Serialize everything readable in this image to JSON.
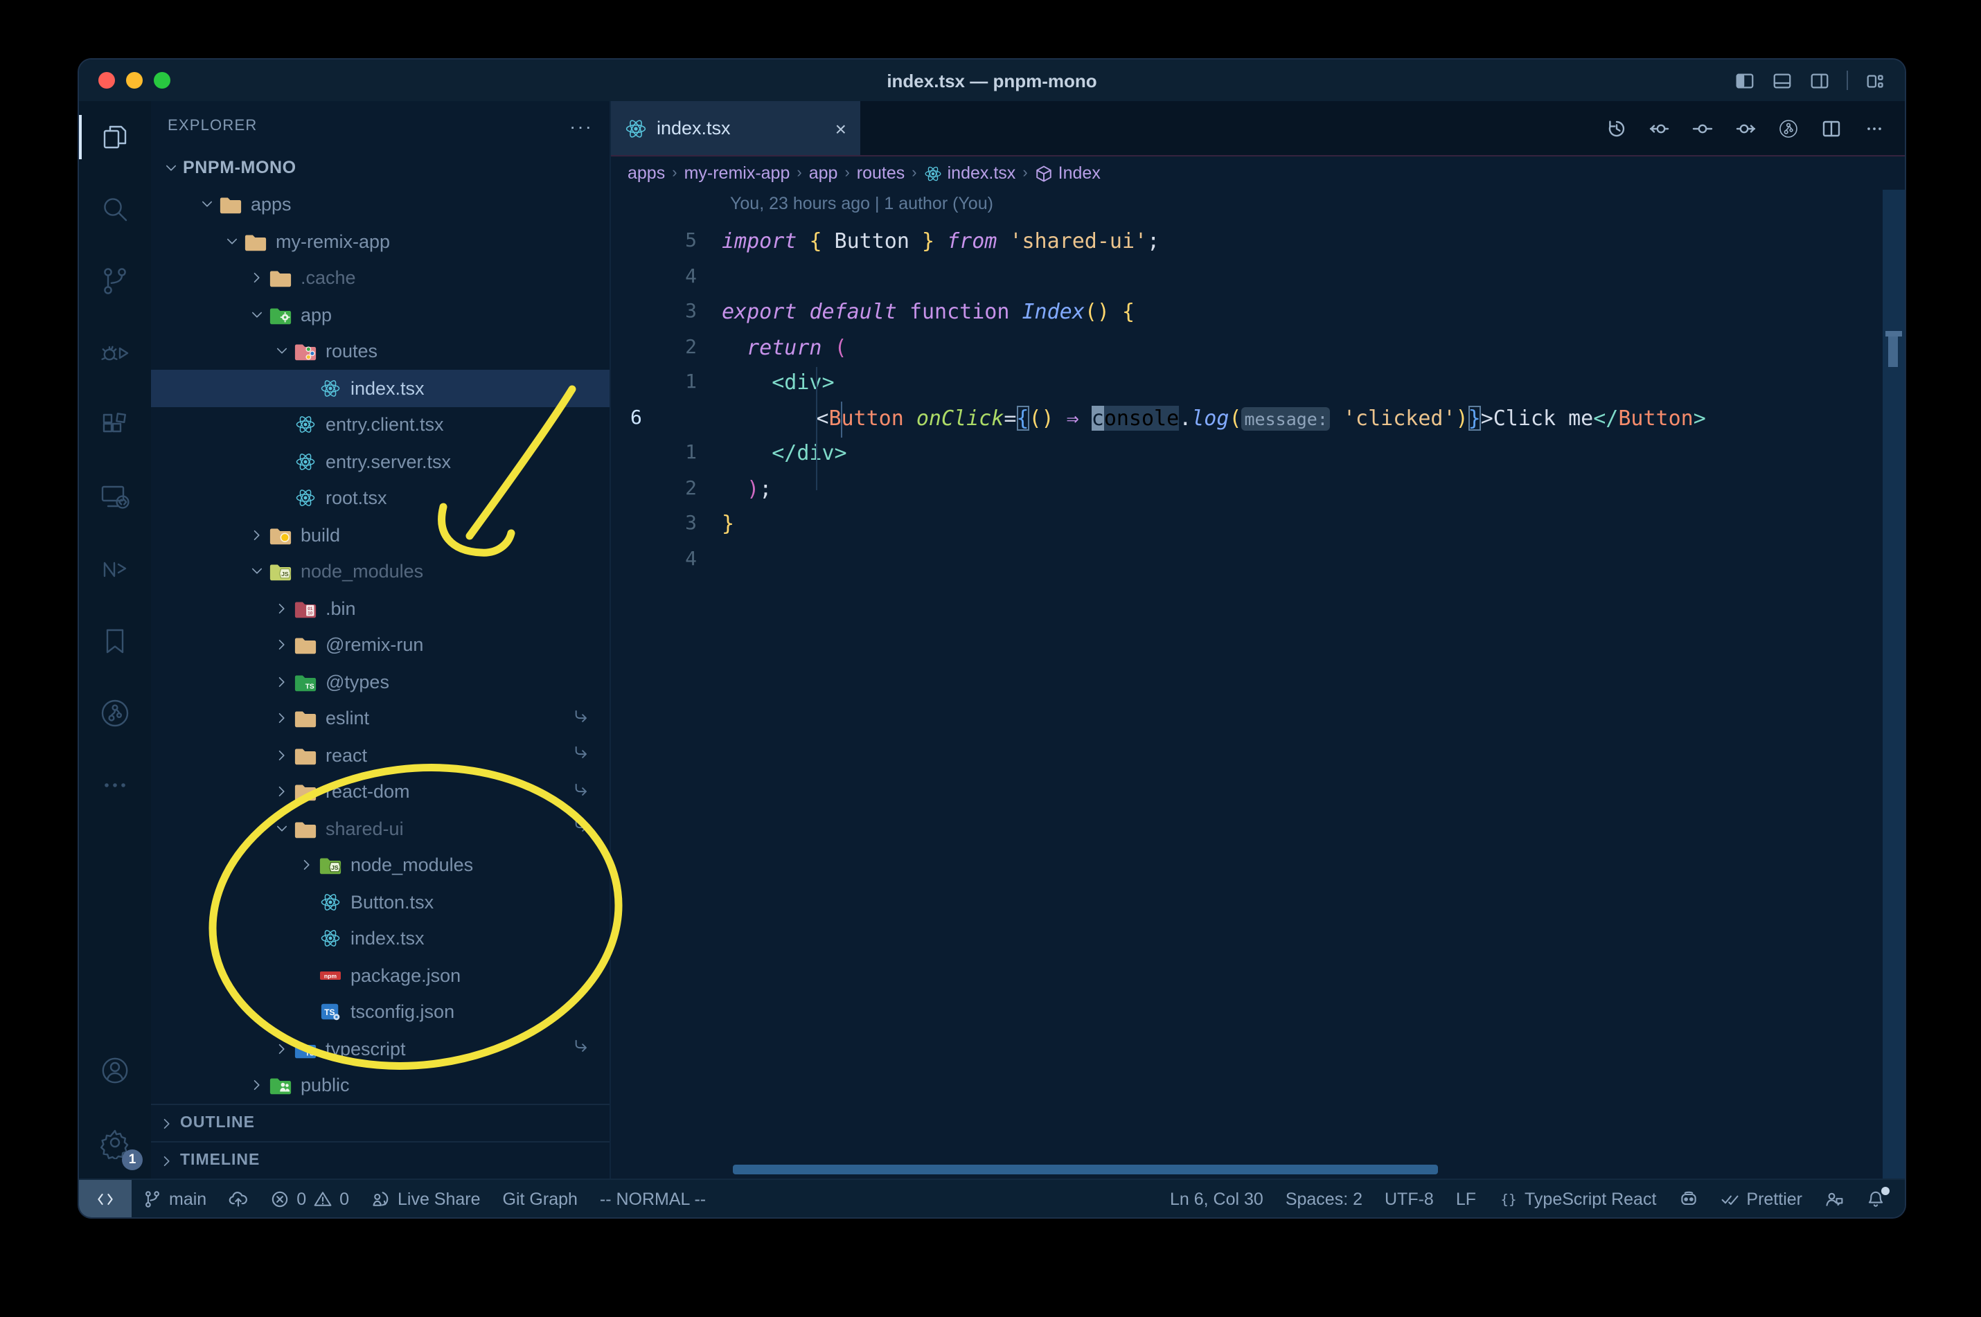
{
  "window": {
    "title": "index.tsx — pnpm-mono"
  },
  "titlebar": {
    "traffic_lights": [
      {
        "name": "close",
        "color": "#ff5f57"
      },
      {
        "name": "minimize",
        "color": "#febc2e"
      },
      {
        "name": "zoom",
        "color": "#28c840"
      }
    ],
    "right_icons": [
      "layout-sidebar-left",
      "layout-panel",
      "layout-sidebar-right",
      "separator",
      "customize-layout"
    ]
  },
  "activity_bar": {
    "top": [
      {
        "name": "explorer",
        "icon": "files",
        "active": true
      },
      {
        "name": "search",
        "icon": "search",
        "active": false
      },
      {
        "name": "source-control",
        "icon": "git-branch-big",
        "active": false
      },
      {
        "name": "run-debug",
        "icon": "debug",
        "active": false
      },
      {
        "name": "extensions",
        "icon": "extensions",
        "active": false
      },
      {
        "name": "remote-explorer",
        "icon": "remote-monitor",
        "active": false
      },
      {
        "name": "nx-console",
        "icon": "nx",
        "active": false
      },
      {
        "name": "bookmarks",
        "icon": "bookmark",
        "active": false
      },
      {
        "name": "git-graph",
        "icon": "git-graph-circle",
        "active": false
      },
      {
        "name": "more",
        "icon": "ellipsis",
        "active": false
      }
    ],
    "bottom": [
      {
        "name": "account",
        "icon": "account",
        "badge": null
      },
      {
        "name": "settings",
        "icon": "gear",
        "badge": "1"
      }
    ]
  },
  "sidebar": {
    "header": "EXPLORER",
    "header_more": "···",
    "root": "PNPM-MONO",
    "tree": [
      {
        "label": "apps",
        "icon": "folder",
        "level": 1,
        "chevron": "down"
      },
      {
        "label": "my-remix-app",
        "icon": "folder",
        "level": 2,
        "chevron": "down"
      },
      {
        "label": ".cache",
        "icon": "folder",
        "level": 3,
        "chevron": "right",
        "dim": true
      },
      {
        "label": "app",
        "icon": "folder-app",
        "level": 3,
        "chevron": "down"
      },
      {
        "label": "routes",
        "icon": "folder-routes",
        "level": 4,
        "chevron": "down"
      },
      {
        "label": "index.tsx",
        "icon": "react",
        "level": 5,
        "selected": true
      },
      {
        "label": "entry.client.tsx",
        "icon": "react",
        "level": 4
      },
      {
        "label": "entry.server.tsx",
        "icon": "react",
        "level": 4
      },
      {
        "label": "root.tsx",
        "icon": "react",
        "level": 4
      },
      {
        "label": "build",
        "icon": "folder-build",
        "level": 3,
        "chevron": "right"
      },
      {
        "label": "node_modules",
        "icon": "folder-js-pale",
        "level": 3,
        "chevron": "down",
        "dim": true
      },
      {
        "label": ".bin",
        "icon": "folder-bin",
        "level": 4,
        "chevron": "right"
      },
      {
        "label": "@remix-run",
        "icon": "folder",
        "level": 4,
        "chevron": "right"
      },
      {
        "label": "@types",
        "icon": "folder-ts-green",
        "level": 4,
        "chevron": "right"
      },
      {
        "label": "eslint",
        "icon": "folder",
        "level": 4,
        "chevron": "right",
        "symlink": true
      },
      {
        "label": "react",
        "icon": "folder",
        "level": 4,
        "chevron": "right",
        "symlink": true
      },
      {
        "label": "react-dom",
        "icon": "folder",
        "level": 4,
        "chevron": "right",
        "symlink": true
      },
      {
        "label": "shared-ui",
        "icon": "folder",
        "level": 4,
        "chevron": "down",
        "dim": true,
        "symlink": true
      },
      {
        "label": "node_modules",
        "icon": "folder-js-green",
        "level": 5,
        "chevron": "right"
      },
      {
        "label": "Button.tsx",
        "icon": "react",
        "level": 5
      },
      {
        "label": "index.tsx",
        "icon": "react",
        "level": 5
      },
      {
        "label": "package.json",
        "icon": "npm",
        "level": 5
      },
      {
        "label": "tsconfig.json",
        "icon": "tsconfig",
        "level": 5
      },
      {
        "label": "typescript",
        "icon": "folder-ts-blue",
        "level": 4,
        "chevron": "right",
        "symlink": true
      },
      {
        "label": "public",
        "icon": "folder-public",
        "level": 3,
        "chevron": "right"
      }
    ],
    "sections": [
      "OUTLINE",
      "TIMELINE"
    ]
  },
  "editor": {
    "tabs": [
      {
        "label": "index.tsx",
        "icon": "react",
        "close": "×",
        "active": true
      }
    ],
    "actions": [
      "history",
      "prev-change",
      "change",
      "next-change",
      "git-graph-circle",
      "split-editor",
      "ellipsis"
    ],
    "breadcrumbs": [
      {
        "label": "apps"
      },
      {
        "label": "my-remix-app"
      },
      {
        "label": "app"
      },
      {
        "label": "routes"
      },
      {
        "label": "index.tsx",
        "icon": "react"
      },
      {
        "label": "Index",
        "icon": "symbol-module"
      }
    ],
    "blame": "You, 23 hours ago | 1 author (You)",
    "code_lines": [
      {
        "num": "5",
        "tokens": [
          [
            "kw",
            "import"
          ],
          [
            "pl",
            " "
          ],
          [
            "by",
            "{"
          ],
          [
            "vr",
            " Button "
          ],
          [
            "by",
            "}"
          ],
          [
            "kw",
            " from"
          ],
          [
            "pl",
            " "
          ],
          [
            "st",
            "'shared-ui'"
          ],
          [
            "pl",
            ";"
          ]
        ]
      },
      {
        "num": "4",
        "tokens": []
      },
      {
        "num": "3",
        "tokens": [
          [
            "kw",
            "export"
          ],
          [
            "pl",
            " "
          ],
          [
            "kw",
            "default"
          ],
          [
            "pl",
            " "
          ],
          [
            "kwu",
            "function"
          ],
          [
            "pl",
            " "
          ],
          [
            "fn",
            "Index"
          ],
          [
            "by",
            "()"
          ],
          [
            "pl",
            " "
          ],
          [
            "by",
            "{"
          ]
        ]
      },
      {
        "num": "2",
        "tokens": [
          [
            "pl",
            "  "
          ],
          [
            "kw",
            "return"
          ],
          [
            "pl",
            " "
          ],
          [
            "bp",
            "("
          ]
        ]
      },
      {
        "num": "1",
        "tokens": [
          [
            "pl",
            "    "
          ],
          [
            "tg",
            "<div>"
          ]
        ]
      },
      {
        "num": "6",
        "active": true,
        "tokens": [
          [
            "pl",
            "      "
          ],
          [
            "pl",
            "<"
          ],
          [
            "cp",
            "Button"
          ],
          [
            "pl",
            " "
          ],
          [
            "at",
            "onClick"
          ],
          [
            "pl",
            "="
          ],
          [
            "bbx",
            "{"
          ],
          [
            "by",
            "()"
          ],
          [
            "pl",
            " "
          ],
          [
            "op",
            "⇒"
          ],
          [
            "pl",
            " "
          ],
          [
            "cur-blk",
            "c"
          ],
          [
            "hl",
            "onsole"
          ],
          [
            "pl",
            "."
          ],
          [
            "fn",
            "log"
          ],
          [
            "by",
            "("
          ],
          [
            "inlay",
            "message:"
          ],
          [
            "pl",
            " "
          ],
          [
            "st",
            "'clicked'"
          ],
          [
            "by",
            ")"
          ],
          [
            "bbx",
            "}"
          ],
          [
            "pl",
            ">"
          ],
          [
            "vr",
            "Click me"
          ],
          [
            "tg",
            "</"
          ],
          [
            "cp",
            "Button"
          ],
          [
            "tg",
            ">"
          ]
        ]
      },
      {
        "num": "1",
        "tokens": [
          [
            "pl",
            "    "
          ],
          [
            "tg",
            "</div>"
          ]
        ]
      },
      {
        "num": "2",
        "tokens": [
          [
            "pl",
            "  "
          ],
          [
            "bp",
            ")"
          ],
          [
            "pl",
            ";"
          ]
        ]
      },
      {
        "num": "3",
        "tokens": [
          [
            "by",
            "}"
          ]
        ]
      },
      {
        "num": "4",
        "tokens": []
      }
    ]
  },
  "status_bar": {
    "left": [
      {
        "name": "remote-indicator",
        "remote": true,
        "parts": [
          {
            "icon": "remote-chevrons"
          }
        ]
      },
      {
        "name": "git-branch",
        "parts": [
          {
            "icon": "branch"
          },
          {
            "text": "main"
          }
        ]
      },
      {
        "name": "sync",
        "parts": [
          {
            "icon": "cloud-upload"
          }
        ]
      },
      {
        "name": "problems",
        "parts": [
          {
            "icon": "error-circle"
          },
          {
            "text": "0"
          },
          {
            "icon": "warning-triangle"
          },
          {
            "text": "0"
          }
        ]
      },
      {
        "name": "live-share",
        "parts": [
          {
            "icon": "live-share"
          },
          {
            "text": "Live Share"
          }
        ]
      },
      {
        "name": "git-graph",
        "parts": [
          {
            "text": "Git Graph"
          }
        ]
      },
      {
        "name": "vim-mode",
        "parts": [
          {
            "text": "-- NORMAL --"
          }
        ]
      }
    ],
    "right": [
      {
        "name": "cursor-position",
        "parts": [
          {
            "text": "Ln 6, Col 30"
          }
        ]
      },
      {
        "name": "indentation",
        "parts": [
          {
            "text": "Spaces: 2"
          }
        ]
      },
      {
        "name": "encoding",
        "parts": [
          {
            "text": "UTF-8"
          }
        ]
      },
      {
        "name": "eol",
        "parts": [
          {
            "text": "LF"
          }
        ]
      },
      {
        "name": "language-mode",
        "parts": [
          {
            "icon": "braces"
          },
          {
            "text": "TypeScript React"
          }
        ]
      },
      {
        "name": "copilot",
        "parts": [
          {
            "icon": "copilot"
          }
        ]
      },
      {
        "name": "prettier",
        "parts": [
          {
            "icon": "check-double"
          },
          {
            "text": "Prettier"
          }
        ]
      },
      {
        "name": "feedback",
        "parts": [
          {
            "icon": "feedback"
          }
        ]
      },
      {
        "name": "notifications",
        "parts": [
          {
            "icon": "bell"
          }
        ],
        "dot": true
      }
    ]
  },
  "annotations": {
    "color": "#f2e33d",
    "shapes": [
      "hand-drawn arrow pointing to node_modules",
      "hand-drawn ellipse around shared-ui package files"
    ]
  },
  "colors": {
    "editor_bg": "#0a1c30",
    "titlebar_bg": "#0d2133",
    "statusbar_bg": "#0c2134",
    "tab_active_bg": "#1b3049",
    "selection_row": "#1b3354",
    "annotation": "#f2e33d",
    "react_icon": "#58c4dc",
    "folder_tan": "#ddb77f",
    "scrollbar": "#2e6190"
  }
}
